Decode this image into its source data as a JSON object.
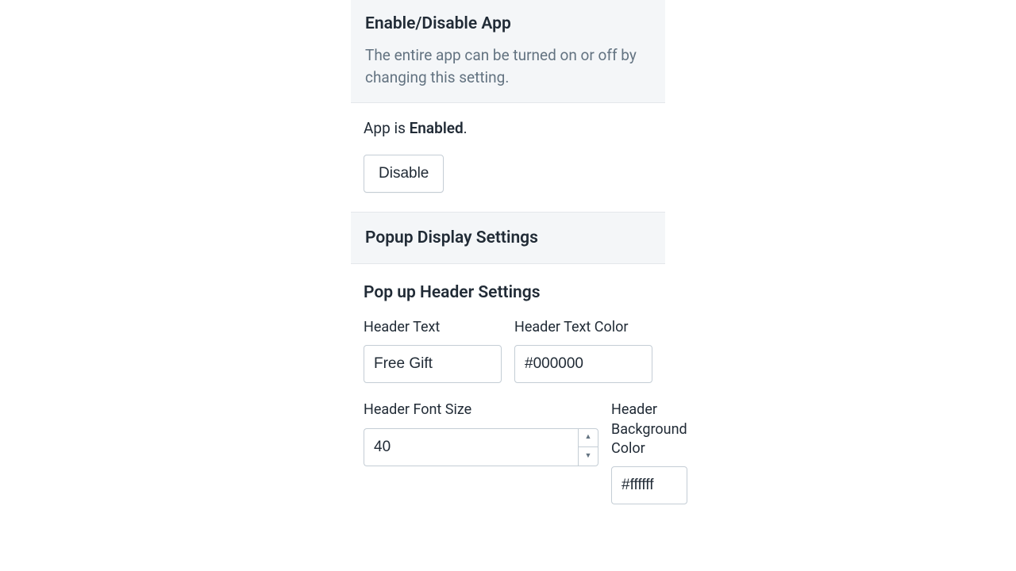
{
  "enable_section": {
    "title": "Enable/Disable App",
    "description": "The entire app can be turned on or off by changing this setting.",
    "status_prefix": "App is ",
    "status_value": "Enabled",
    "status_suffix": ".",
    "button_label": "Disable"
  },
  "popup_section": {
    "title": "Popup Display Settings",
    "subsection_title": "Pop up Header Settings",
    "fields": {
      "header_text": {
        "label": "Header Text",
        "value": "Free Gift"
      },
      "header_text_color": {
        "label": "Header Text Color",
        "value": "#000000"
      },
      "header_font_size": {
        "label": "Header Font Size",
        "value": "40"
      },
      "header_bg_color": {
        "label": "Header Background Color",
        "value": "#ffffff"
      }
    }
  }
}
